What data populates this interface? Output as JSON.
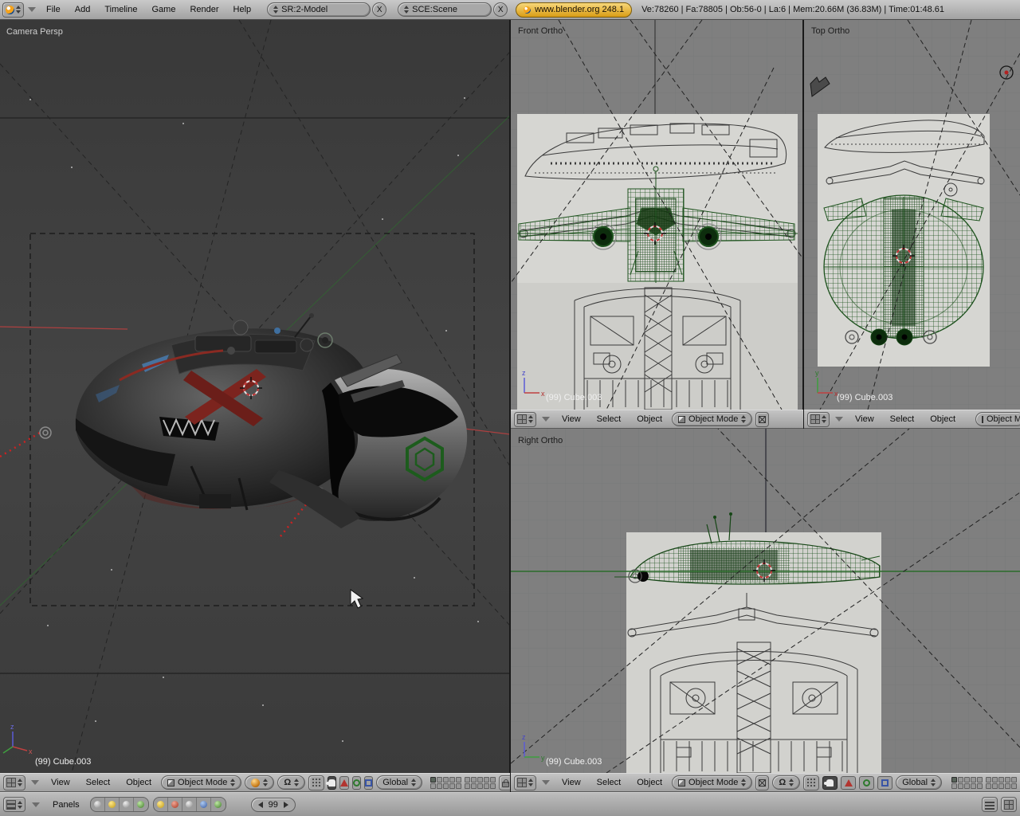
{
  "topbar": {
    "menus": [
      "File",
      "Add",
      "Timeline",
      "Game",
      "Render",
      "Help"
    ],
    "screen_selector": {
      "label": "SR:2-Model",
      "close": "X"
    },
    "scene_selector": {
      "label": "SCE:Scene",
      "close": "X"
    },
    "version_badge": "www.blender.org 248.1",
    "stats": "Ve:78260 | Fa:78805 | Ob:56-0 | La:6 | Mem:20.66M (36.83M) | Time:01:48.61"
  },
  "viewport_header": {
    "menus": [
      "View",
      "Select",
      "Object"
    ],
    "mode_label": "Object Mode",
    "orientation_label": "Global"
  },
  "viewports": {
    "camera": {
      "label": "Camera Persp",
      "object_label": "(99) Cube.003"
    },
    "front": {
      "label": "Front Ortho",
      "object_label": "(99) Cube.003"
    },
    "top": {
      "label": "Top Ortho",
      "object_label": "(99) Cube.003"
    },
    "right": {
      "label": "Right Ortho",
      "object_label": "(99) Cube.003"
    }
  },
  "buttons_bar": {
    "panels_label": "Panels",
    "frame": "99"
  },
  "icons": {
    "pivot": "Ω"
  },
  "axes": {
    "x": "x",
    "y": "y",
    "z": "z"
  },
  "colors": {
    "header_grey": "#b3b3b3",
    "badge_yellow": "#e8a91c",
    "wireframe_green": "#1d521d",
    "cursor_red": "#c23030",
    "viewport_dark": "#3d3d3d",
    "ortho_grey": "#7f7f7f"
  }
}
